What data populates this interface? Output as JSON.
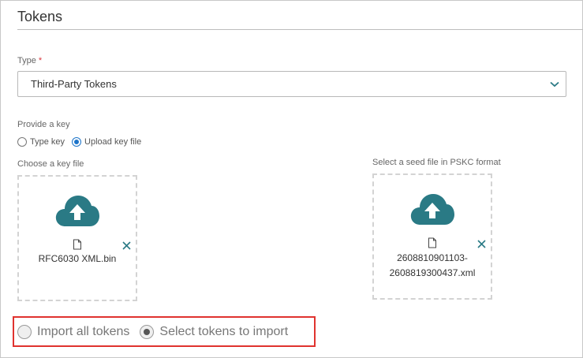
{
  "section": {
    "title": "Tokens"
  },
  "type_field": {
    "label": "Type",
    "required_mark": "*",
    "value": "Third-Party Tokens"
  },
  "key_field": {
    "label": "Provide a key",
    "options": [
      {
        "label": "Type key",
        "selected": false
      },
      {
        "label": "Upload key file",
        "selected": true
      }
    ]
  },
  "key_file": {
    "label": "Choose a key file",
    "file_name": "RFC6030 XML.bin"
  },
  "seed_file": {
    "label": "Select a seed file in PSKC format",
    "file_name_line1": "2608810901103-",
    "file_name_line2": "2608819300437.xml"
  },
  "import_options": [
    {
      "label": "Import all tokens",
      "selected": false
    },
    {
      "label": "Select tokens to import",
      "selected": true
    }
  ],
  "colors": {
    "accent": "#1c74c9",
    "cloud": "#2a7a85",
    "highlight_border": "#e0332f"
  },
  "icons": {
    "upload": "cloud-upload-icon",
    "file": "file-icon",
    "remove": "close-icon",
    "dropdown": "chevron-down-icon"
  }
}
